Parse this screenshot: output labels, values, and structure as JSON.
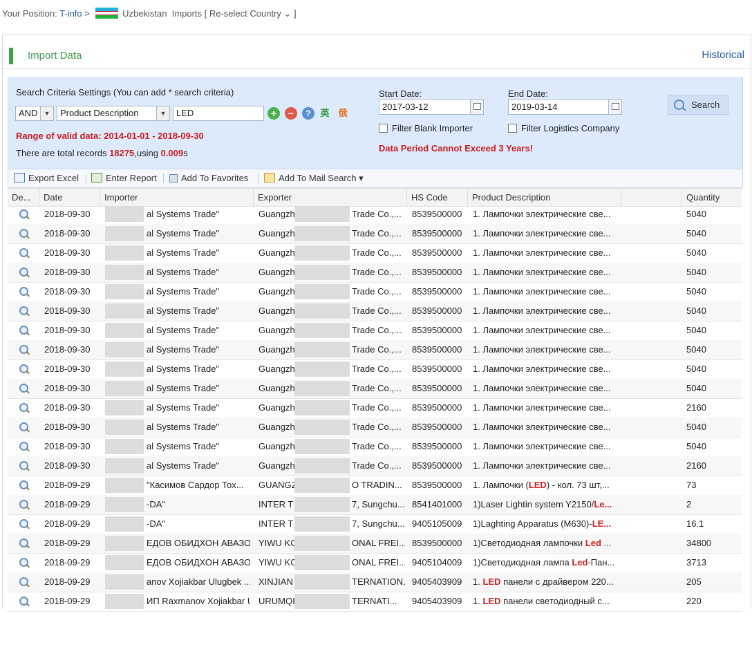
{
  "breadcrumb": {
    "prefix": "Your Position:",
    "home": "T-info",
    "sep": ">",
    "country": "Uzbekistan",
    "section": "Imports",
    "reselect": "[ Re-select Country ⌄ ]"
  },
  "panel": {
    "title": "Import Data",
    "historical": "Historical"
  },
  "criteria": {
    "title": "Search Criteria Settings (You can add * search criteria)",
    "logic": "AND",
    "field": "Product Description",
    "value": "LED",
    "lang_en": "英",
    "lang_ru": "俄",
    "range_label": "Range of valid data: 2014-01-01 - 2018-09-30",
    "total_prefix": "There are total records ",
    "total_count": "18275",
    "total_mid": ",using ",
    "total_time": "0.009",
    "total_suffix": "s",
    "start_label": "Start Date:",
    "start_value": "2017-03-12",
    "end_label": "End Date:",
    "end_value": "2019-03-14",
    "filter_blank": "Filter Blank Importer",
    "filter_logistics": "Filter Logistics Company",
    "warning": "Data Period Cannot Exceed 3 Years!",
    "search_label": "Search"
  },
  "toolbar": {
    "export": "Export Excel",
    "report": "Enter Report",
    "favorites": "Add To Favorites",
    "mail": "Add To Mail Search ▾"
  },
  "table": {
    "headers": [
      "De...",
      "Date",
      "Importer",
      "Exporter",
      "HS Code",
      "Product Description",
      "Quantity"
    ],
    "rows": [
      {
        "date": "2018-09-30",
        "importer": "al Systems Trade\"",
        "exporter_a": "Guangzh",
        "exporter_b": "Trade Co.,...",
        "hs": "8539500000",
        "desc": "1. Лампочки электрические све...",
        "desc_hl": "",
        "desc_tail": "",
        "qty": "5040"
      },
      {
        "date": "2018-09-30",
        "importer": "al Systems Trade\"",
        "exporter_a": "Guangzh",
        "exporter_b": "Trade Co.,...",
        "hs": "8539500000",
        "desc": "1. Лампочки электрические све...",
        "desc_hl": "",
        "desc_tail": "",
        "qty": "5040"
      },
      {
        "date": "2018-09-30",
        "importer": "al Systems Trade\"",
        "exporter_a": "Guangzh",
        "exporter_b": "Trade Co.,...",
        "hs": "8539500000",
        "desc": "1. Лампочки электрические све...",
        "desc_hl": "",
        "desc_tail": "",
        "qty": "5040"
      },
      {
        "date": "2018-09-30",
        "importer": "al Systems Trade\"",
        "exporter_a": "Guangzh",
        "exporter_b": "Trade Co.,...",
        "hs": "8539500000",
        "desc": "1. Лампочки электрические све...",
        "desc_hl": "",
        "desc_tail": "",
        "qty": "5040"
      },
      {
        "date": "2018-09-30",
        "importer": "al Systems Trade\"",
        "exporter_a": "Guangzh",
        "exporter_b": "Trade Co.,...",
        "hs": "8539500000",
        "desc": "1. Лампочки электрические све...",
        "desc_hl": "",
        "desc_tail": "",
        "qty": "5040"
      },
      {
        "date": "2018-09-30",
        "importer": "al Systems Trade\"",
        "exporter_a": "Guangzh",
        "exporter_b": "Trade Co.,...",
        "hs": "8539500000",
        "desc": "1. Лампочки электрические све...",
        "desc_hl": "",
        "desc_tail": "",
        "qty": "5040"
      },
      {
        "date": "2018-09-30",
        "importer": "al Systems Trade\"",
        "exporter_a": "Guangzh",
        "exporter_b": "Trade Co.,...",
        "hs": "8539500000",
        "desc": "1. Лампочки электрические све...",
        "desc_hl": "",
        "desc_tail": "",
        "qty": "5040"
      },
      {
        "date": "2018-09-30",
        "importer": "al Systems Trade\"",
        "exporter_a": "Guangzh",
        "exporter_b": "Trade Co.,...",
        "hs": "8539500000",
        "desc": "1. Лампочки электрические све...",
        "desc_hl": "",
        "desc_tail": "",
        "qty": "5040"
      },
      {
        "date": "2018-09-30",
        "importer": "al Systems Trade\"",
        "exporter_a": "Guangzh",
        "exporter_b": "Trade Co.,...",
        "hs": "8539500000",
        "desc": "1. Лампочки электрические све...",
        "desc_hl": "",
        "desc_tail": "",
        "qty": "5040"
      },
      {
        "date": "2018-09-30",
        "importer": "al Systems Trade\"",
        "exporter_a": "Guangzh",
        "exporter_b": "Trade Co.,...",
        "hs": "8539500000",
        "desc": "1. Лампочки электрические све...",
        "desc_hl": "",
        "desc_tail": "",
        "qty": "5040"
      },
      {
        "date": "2018-09-30",
        "importer": "al Systems Trade\"",
        "exporter_a": "Guangzh",
        "exporter_b": "Trade Co.,...",
        "hs": "8539500000",
        "desc": "1. Лампочки электрические све...",
        "desc_hl": "",
        "desc_tail": "",
        "qty": "2160"
      },
      {
        "date": "2018-09-30",
        "importer": "al Systems Trade\"",
        "exporter_a": "Guangzh",
        "exporter_b": "Trade Co.,...",
        "hs": "8539500000",
        "desc": "1. Лампочки электрические све...",
        "desc_hl": "",
        "desc_tail": "",
        "qty": "5040"
      },
      {
        "date": "2018-09-30",
        "importer": "al Systems Trade\"",
        "exporter_a": "Guangzh",
        "exporter_b": "Trade Co.,...",
        "hs": "8539500000",
        "desc": "1. Лампочки электрические све...",
        "desc_hl": "",
        "desc_tail": "",
        "qty": "5040"
      },
      {
        "date": "2018-09-30",
        "importer": "al Systems Trade\"",
        "exporter_a": "Guangzh",
        "exporter_b": "Trade Co.,...",
        "hs": "8539500000",
        "desc": "1. Лампочки электрические све...",
        "desc_hl": "",
        "desc_tail": "",
        "qty": "2160"
      },
      {
        "date": "2018-09-29",
        "importer": "\"Касимов Сардор Тох...",
        "exporter_a": "GUANGZ",
        "exporter_b": "O TRADIN...",
        "hs": "8539500000",
        "desc": "1. Лампочки (",
        "desc_hl": "LED",
        "desc_tail": ") - кол. 73 шт,...",
        "qty": "73"
      },
      {
        "date": "2018-09-29",
        "importer": "-DA\"",
        "exporter_a": "INTER T",
        "exporter_b": "7, Sungchu...",
        "hs": "8541401000",
        "desc": "1)Laser Lightin system Y2150/",
        "desc_hl": "Le...",
        "desc_tail": "",
        "qty": "2"
      },
      {
        "date": "2018-09-29",
        "importer": "-DA\"",
        "exporter_a": "INTER T",
        "exporter_b": "7, Sungchu...",
        "hs": "9405105009",
        "desc": "1)Laghting Apparatus (M630)-",
        "desc_hl": "LE...",
        "desc_tail": "",
        "qty": "16.1"
      },
      {
        "date": "2018-09-29",
        "importer": "ЕДОВ ОБИДХОН АВАЗО...",
        "exporter_a": "YIWU KC",
        "exporter_b": "ONAL FREI...",
        "hs": "8539500000",
        "desc": "1)Светодиодная лампочки ",
        "desc_hl": "Led",
        "desc_tail": " ...",
        "qty": "34800"
      },
      {
        "date": "2018-09-29",
        "importer": "ЕДОВ ОБИДХОН АВАЗО...",
        "exporter_a": "YIWU KC",
        "exporter_b": "ONAL FREI...",
        "hs": "9405104009",
        "desc": "1)Светодиодная лампа ",
        "desc_hl": "Led",
        "desc_tail": "-Пан...",
        "qty": "3713"
      },
      {
        "date": "2018-09-29",
        "importer": "anov Xojiakbar Ulugbek ...",
        "exporter_a": "XINJIAN",
        "exporter_b": "TERNATION...",
        "hs": "9405403909",
        "desc": "1. ",
        "desc_hl": "LED",
        "desc_tail": " панели с драйвером 220...",
        "qty": "205"
      },
      {
        "date": "2018-09-29",
        "importer": "ИП Raxmanov Xojiakbar Ulugbek ...",
        "exporter_a": "URUMQI",
        "exporter_b": "TERNATI...",
        "hs": "9405403909",
        "desc": "1. ",
        "desc_hl": "LED",
        "desc_tail": " панели светодиодный с...",
        "qty": "220"
      }
    ]
  },
  "colors": {
    "accent_green": "#3da34a",
    "link_blue": "#1a5a9c",
    "alert_red": "#c81e1e",
    "criteria_bg": "#ddeafc"
  }
}
